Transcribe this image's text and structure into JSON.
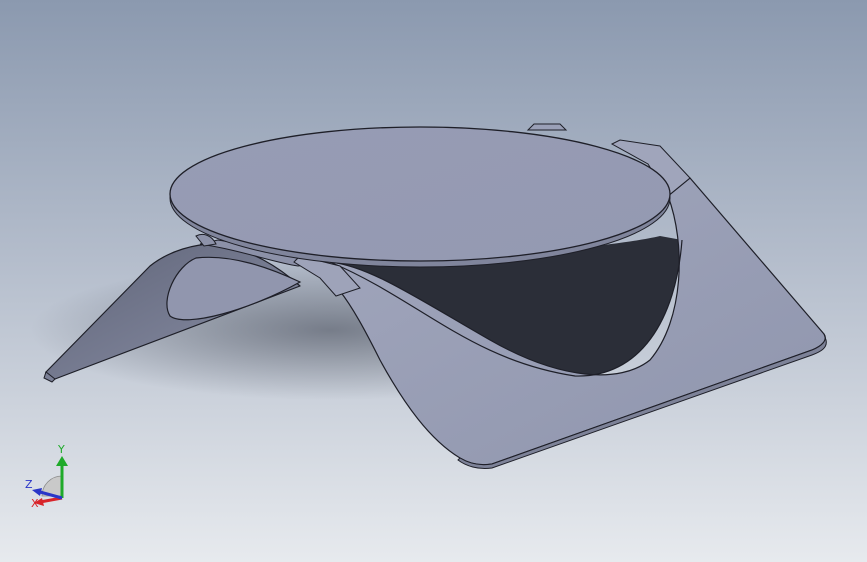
{
  "viewport": {
    "background_top": "#8c9ab0",
    "background_bottom": "#e6e9ee",
    "part_color": "#979db5",
    "edge_color": "#1e1f28"
  },
  "triad": {
    "y_label": "Y",
    "z_label": "Z",
    "x_label": "X",
    "y_color": "#1faa2a",
    "x_color": "#d8242a",
    "z_color": "#2a36c8"
  }
}
